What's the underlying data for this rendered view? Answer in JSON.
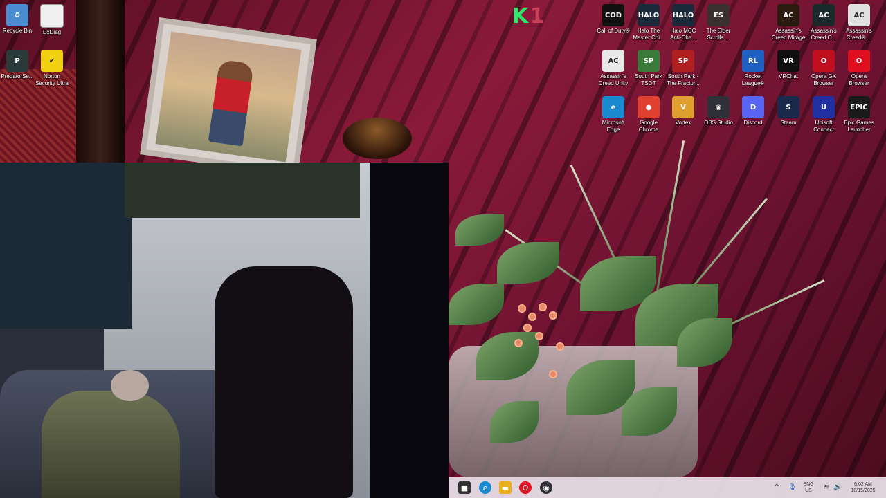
{
  "desktop": {
    "overlay_logo": {
      "main": "K",
      "accent": "1"
    },
    "icons_left": [
      {
        "label": "Recycle Bin",
        "icon": "recycle-bin-icon",
        "glyph": "♻",
        "color": "#4a8cd0"
      },
      {
        "label": "DxDiag",
        "icon": "document-icon",
        "glyph": "",
        "color": "#f0f0f0"
      },
      {
        "label": "PredatorSe...",
        "icon": "predator-icon",
        "glyph": "P",
        "color": "#2a3a3a"
      },
      {
        "label": "Norton Security Ultra",
        "icon": "norton-icon",
        "glyph": "✔",
        "color": "#f0d010"
      }
    ],
    "icons_right": [
      {
        "label": "Call of Duty®",
        "icon": "call-of-duty-icon",
        "glyph": "COD",
        "color": "#101010"
      },
      {
        "label": "Halo The Master Chi...",
        "icon": "halo-icon",
        "glyph": "HALO",
        "color": "#1a2a3a"
      },
      {
        "label": "Halo MCC Anti-Che...",
        "icon": "halo-mcc-icon",
        "glyph": "HALO",
        "color": "#1a2a3a"
      },
      {
        "label": "The Elder Scrolls ...",
        "icon": "elder-scrolls-icon",
        "glyph": "ES",
        "color": "#3a3030"
      },
      {
        "label": "Assassin's Creed Mirage",
        "icon": "assassins-creed-mirage-icon",
        "glyph": "AC",
        "color": "#2a1a10"
      },
      {
        "label": "Assassin's Creed O...",
        "icon": "assassins-creed-odyssey-icon",
        "glyph": "AC",
        "color": "#1a2a2a"
      },
      {
        "label": "Assassin's Creed® ...",
        "icon": "assassins-creed-icon",
        "glyph": "AC",
        "color": "#e0e0e0"
      },
      {
        "label": "Assassin's Creed Unity",
        "icon": "assassins-creed-unity-icon",
        "glyph": "AC",
        "color": "#e8e8e8"
      },
      {
        "label": "South Park TSOT",
        "icon": "south-park-tsot-icon",
        "glyph": "SP",
        "color": "#3a7a3a"
      },
      {
        "label": "South Park - The Fractur...",
        "icon": "south-park-fractured-icon",
        "glyph": "SP",
        "color": "#b02020"
      },
      {
        "label": "Rocket League®",
        "icon": "rocket-league-icon",
        "glyph": "RL",
        "color": "#2060c0"
      },
      {
        "label": "VRChat",
        "icon": "vrchat-icon",
        "glyph": "VR",
        "color": "#101010"
      },
      {
        "label": "Opera GX Browser",
        "icon": "opera-gx-icon",
        "glyph": "O",
        "color": "#c01020"
      },
      {
        "label": "Opera Browser",
        "icon": "opera-icon",
        "glyph": "O",
        "color": "#e01020"
      },
      {
        "label": "Microsoft Edge",
        "icon": "edge-icon",
        "glyph": "e",
        "color": "#1a8ad0"
      },
      {
        "label": "Google Chrome",
        "icon": "chrome-icon",
        "glyph": "●",
        "color": "#e04030"
      },
      {
        "label": "Vortex",
        "icon": "vortex-icon",
        "glyph": "V",
        "color": "#e0a030"
      },
      {
        "label": "OBS Studio",
        "icon": "obs-icon",
        "glyph": "◉",
        "color": "#303038"
      },
      {
        "label": "Discord",
        "icon": "discord-icon",
        "glyph": "D",
        "color": "#5865f2"
      },
      {
        "label": "Steam",
        "icon": "steam-icon",
        "glyph": "S",
        "color": "#1a2a4a"
      },
      {
        "label": "Ubisoft Connect",
        "icon": "ubisoft-icon",
        "glyph": "U",
        "color": "#2030a0"
      },
      {
        "label": "Epic Games Launcher",
        "icon": "epic-games-icon",
        "glyph": "EPIC",
        "color": "#1a1a1a"
      }
    ]
  },
  "taskbar": {
    "items": [
      {
        "icon": "square-icon",
        "glyph": "■",
        "color": "#333333"
      },
      {
        "icon": "edge-icon",
        "glyph": "e",
        "color": "#1a8ad0"
      },
      {
        "icon": "file-explorer-icon",
        "glyph": "▬",
        "color": "#e8b020"
      },
      {
        "icon": "opera-icon",
        "glyph": "O",
        "color": "#e01020"
      },
      {
        "icon": "obs-icon",
        "glyph": "◉",
        "color": "#303038"
      }
    ],
    "tray": {
      "language_top": "ENG",
      "language_bottom": "US",
      "time": "6:02 AM",
      "date": "10/15/2025"
    }
  }
}
